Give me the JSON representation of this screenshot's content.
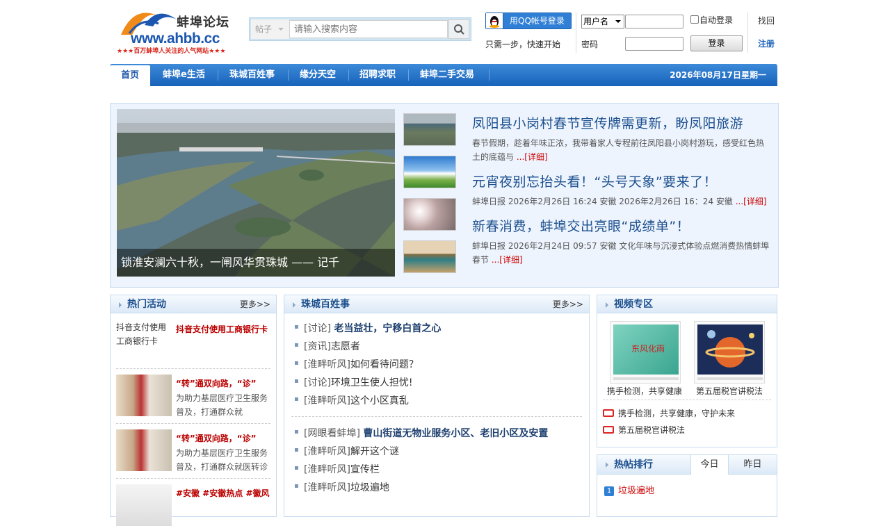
{
  "header": {
    "logo": {
      "name": "蚌埠论坛",
      "url": "www.ahbb.cc",
      "slogan": "★★★百万蚌埠人关注的人气网站★★★"
    },
    "search": {
      "type": "帖子",
      "placeholder": "请输入搜索内容"
    },
    "login": {
      "qq_button": "用QQ帐号登录",
      "quick_text": "只需一步，快速开始",
      "username_select": "用户名",
      "password_label": "密码",
      "auto_login": "自动登录",
      "login_button": "登录",
      "switch": "找回",
      "register": "注册"
    }
  },
  "nav": {
    "items": [
      "首页",
      "蚌埠e生活",
      "珠城百姓事",
      "缘分天空",
      "招聘求职",
      "蚌埠二手交易"
    ],
    "date": "2026年08月17日星期一"
  },
  "focus": {
    "big_caption": "锁淮安澜六十秋，一闸风华贯珠城 —— 记千",
    "news": [
      {
        "title": "凤阳县小岗村春节宣传牌需更新，盼凤阳旅游",
        "summary": "春节假期，趁着年味正浓，我带着家人专程前往凤阳县小岗村游玩，感受红色热土的底蕴与",
        "more": "...[详细]"
      },
      {
        "title": "元宵夜别忘抬头看！“头号天象”要来了！",
        "summary": "蚌埠日报 2026年2月26日 16:24 安徽 2026年2月26日 16：24 安徽",
        "more": "...[详细]"
      },
      {
        "title": "新春消费，蚌埠交出亮眼“成绩单”！",
        "summary": "蚌埠日报 2026年2月24日 09:57 安徽 文化年味与沉浸式体验点燃消费热情蚌埠春节",
        "more": "...[详细]"
      }
    ]
  },
  "hot_activity": {
    "title": "热门活动",
    "more": "更多>>",
    "items": [
      {
        "img_alt": "抖音支付使用工商银行卡",
        "title": "抖音支付使用工商银行卡",
        "summary": ""
      },
      {
        "img_alt": "",
        "title": "“转”通双向路，“诊”",
        "summary": "为助力基层医疗卫生服务普及，打通群众就"
      },
      {
        "img_alt": "",
        "title": "“转”通双向路，“诊”",
        "summary": "为助力基层医疗卫生服务普及，打通群众就医转诊"
      },
      {
        "img_alt": "",
        "title": "#安徽 #安徽热点 #徽风",
        "summary": ""
      }
    ]
  },
  "zhucheng": {
    "title": "珠城百姓事",
    "more": "更多>>",
    "group1": [
      {
        "tag": "[讨论]",
        "text": "老当益壮，宁移白首之心",
        "bold": true
      },
      {
        "tag": "[资讯]",
        "text": "志愿者",
        "bold": false
      },
      {
        "tag": "[淮畔听风]",
        "text": "如何看待问题？",
        "bold": false
      },
      {
        "tag": "[讨论]",
        "text": "环境卫生使人担忧!",
        "bold": false
      },
      {
        "tag": "[淮畔听风]",
        "text": "这个小区真乱",
        "bold": false
      }
    ],
    "group2": [
      {
        "tag": "[网眼看蚌埠]",
        "text": "曹山街道无物业服务小区、老旧小区及安置",
        "bold": true
      },
      {
        "tag": "[淮畔听风]",
        "text": "解开这个谜",
        "bold": false
      },
      {
        "tag": "[淮畔听风]",
        "text": "宣传栏",
        "bold": false
      },
      {
        "tag": "[淮畔听风]",
        "text": "垃圾遍地",
        "bold": false
      }
    ]
  },
  "video": {
    "title": "视频专区",
    "thumbs": [
      {
        "caption": "携手检测，共享健康",
        "overlay": "东风化雨"
      },
      {
        "caption": "第五届税官讲税法",
        "overlay": ""
      }
    ],
    "list": [
      "携手检测，共享健康，守护未来",
      "第五届税官讲税法"
    ]
  },
  "hot_rank": {
    "title": "热帖排行",
    "tabs": [
      "今日",
      "昨日"
    ],
    "items": [
      {
        "rank": "1",
        "text": "垃圾遍地"
      }
    ]
  },
  "colors": {
    "brand_blue": "#1862bb",
    "link_dark": "#1c4f8e",
    "accent_red": "#c00000"
  }
}
